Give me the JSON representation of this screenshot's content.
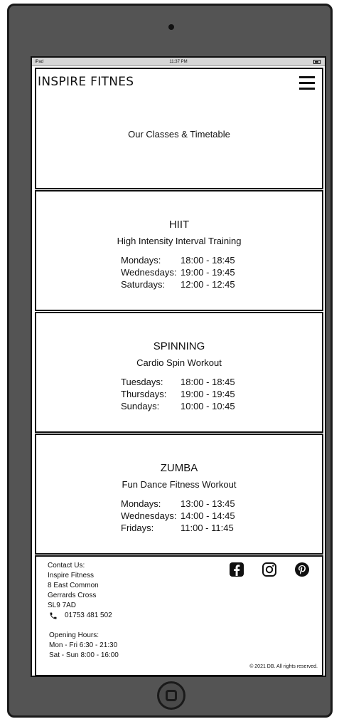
{
  "statusbar": {
    "carrier": "iPad",
    "time": "11:37 PM"
  },
  "header": {
    "brand": "INSPIRE FITNES",
    "page_title": "Our Classes & Timetable"
  },
  "classes": [
    {
      "name": "HIIT",
      "subtitle": "High Intensity Interval Training",
      "schedule": [
        {
          "day": "Mondays:",
          "time": "18:00 - 18:45"
        },
        {
          "day": "Wednesdays:",
          "time": "19:00 - 19:45"
        },
        {
          "day": "Saturdays:",
          "time": "12:00 - 12:45"
        }
      ]
    },
    {
      "name": "SPINNING",
      "subtitle": "Cardio Spin Workout",
      "schedule": [
        {
          "day": "Tuesdays:",
          "time": "18:00 - 18:45"
        },
        {
          "day": "Thursdays:",
          "time": "19:00 - 19:45"
        },
        {
          "day": "Sundays:",
          "time": "10:00 - 10:45"
        }
      ]
    },
    {
      "name": "ZUMBA",
      "subtitle": "Fun Dance Fitness Workout",
      "schedule": [
        {
          "day": "Mondays:",
          "time": "13:00 - 13:45"
        },
        {
          "day": "Wednesdays:",
          "time": "14:00 - 14:45"
        },
        {
          "day": "Fridays:",
          "time": "11:00 - 11:45"
        }
      ]
    }
  ],
  "footer": {
    "contact_heading": "Contact Us:",
    "company": "Inspire Fitness",
    "address_line1": "8 East Common",
    "address_line2": "Gerrards Cross",
    "postcode": "SL9 7AD",
    "phone": "01753 481 502",
    "hours_heading": "Opening Hours:",
    "hours_weekday": "Mon - Fri 6:30 - 21:30",
    "hours_weekend": "Sat - Sun 8:00 - 16:00",
    "copyright": "© 2021 DB. All rights reserved.",
    "social_icons": [
      "facebook-icon",
      "instagram-icon",
      "pinterest-icon"
    ]
  }
}
